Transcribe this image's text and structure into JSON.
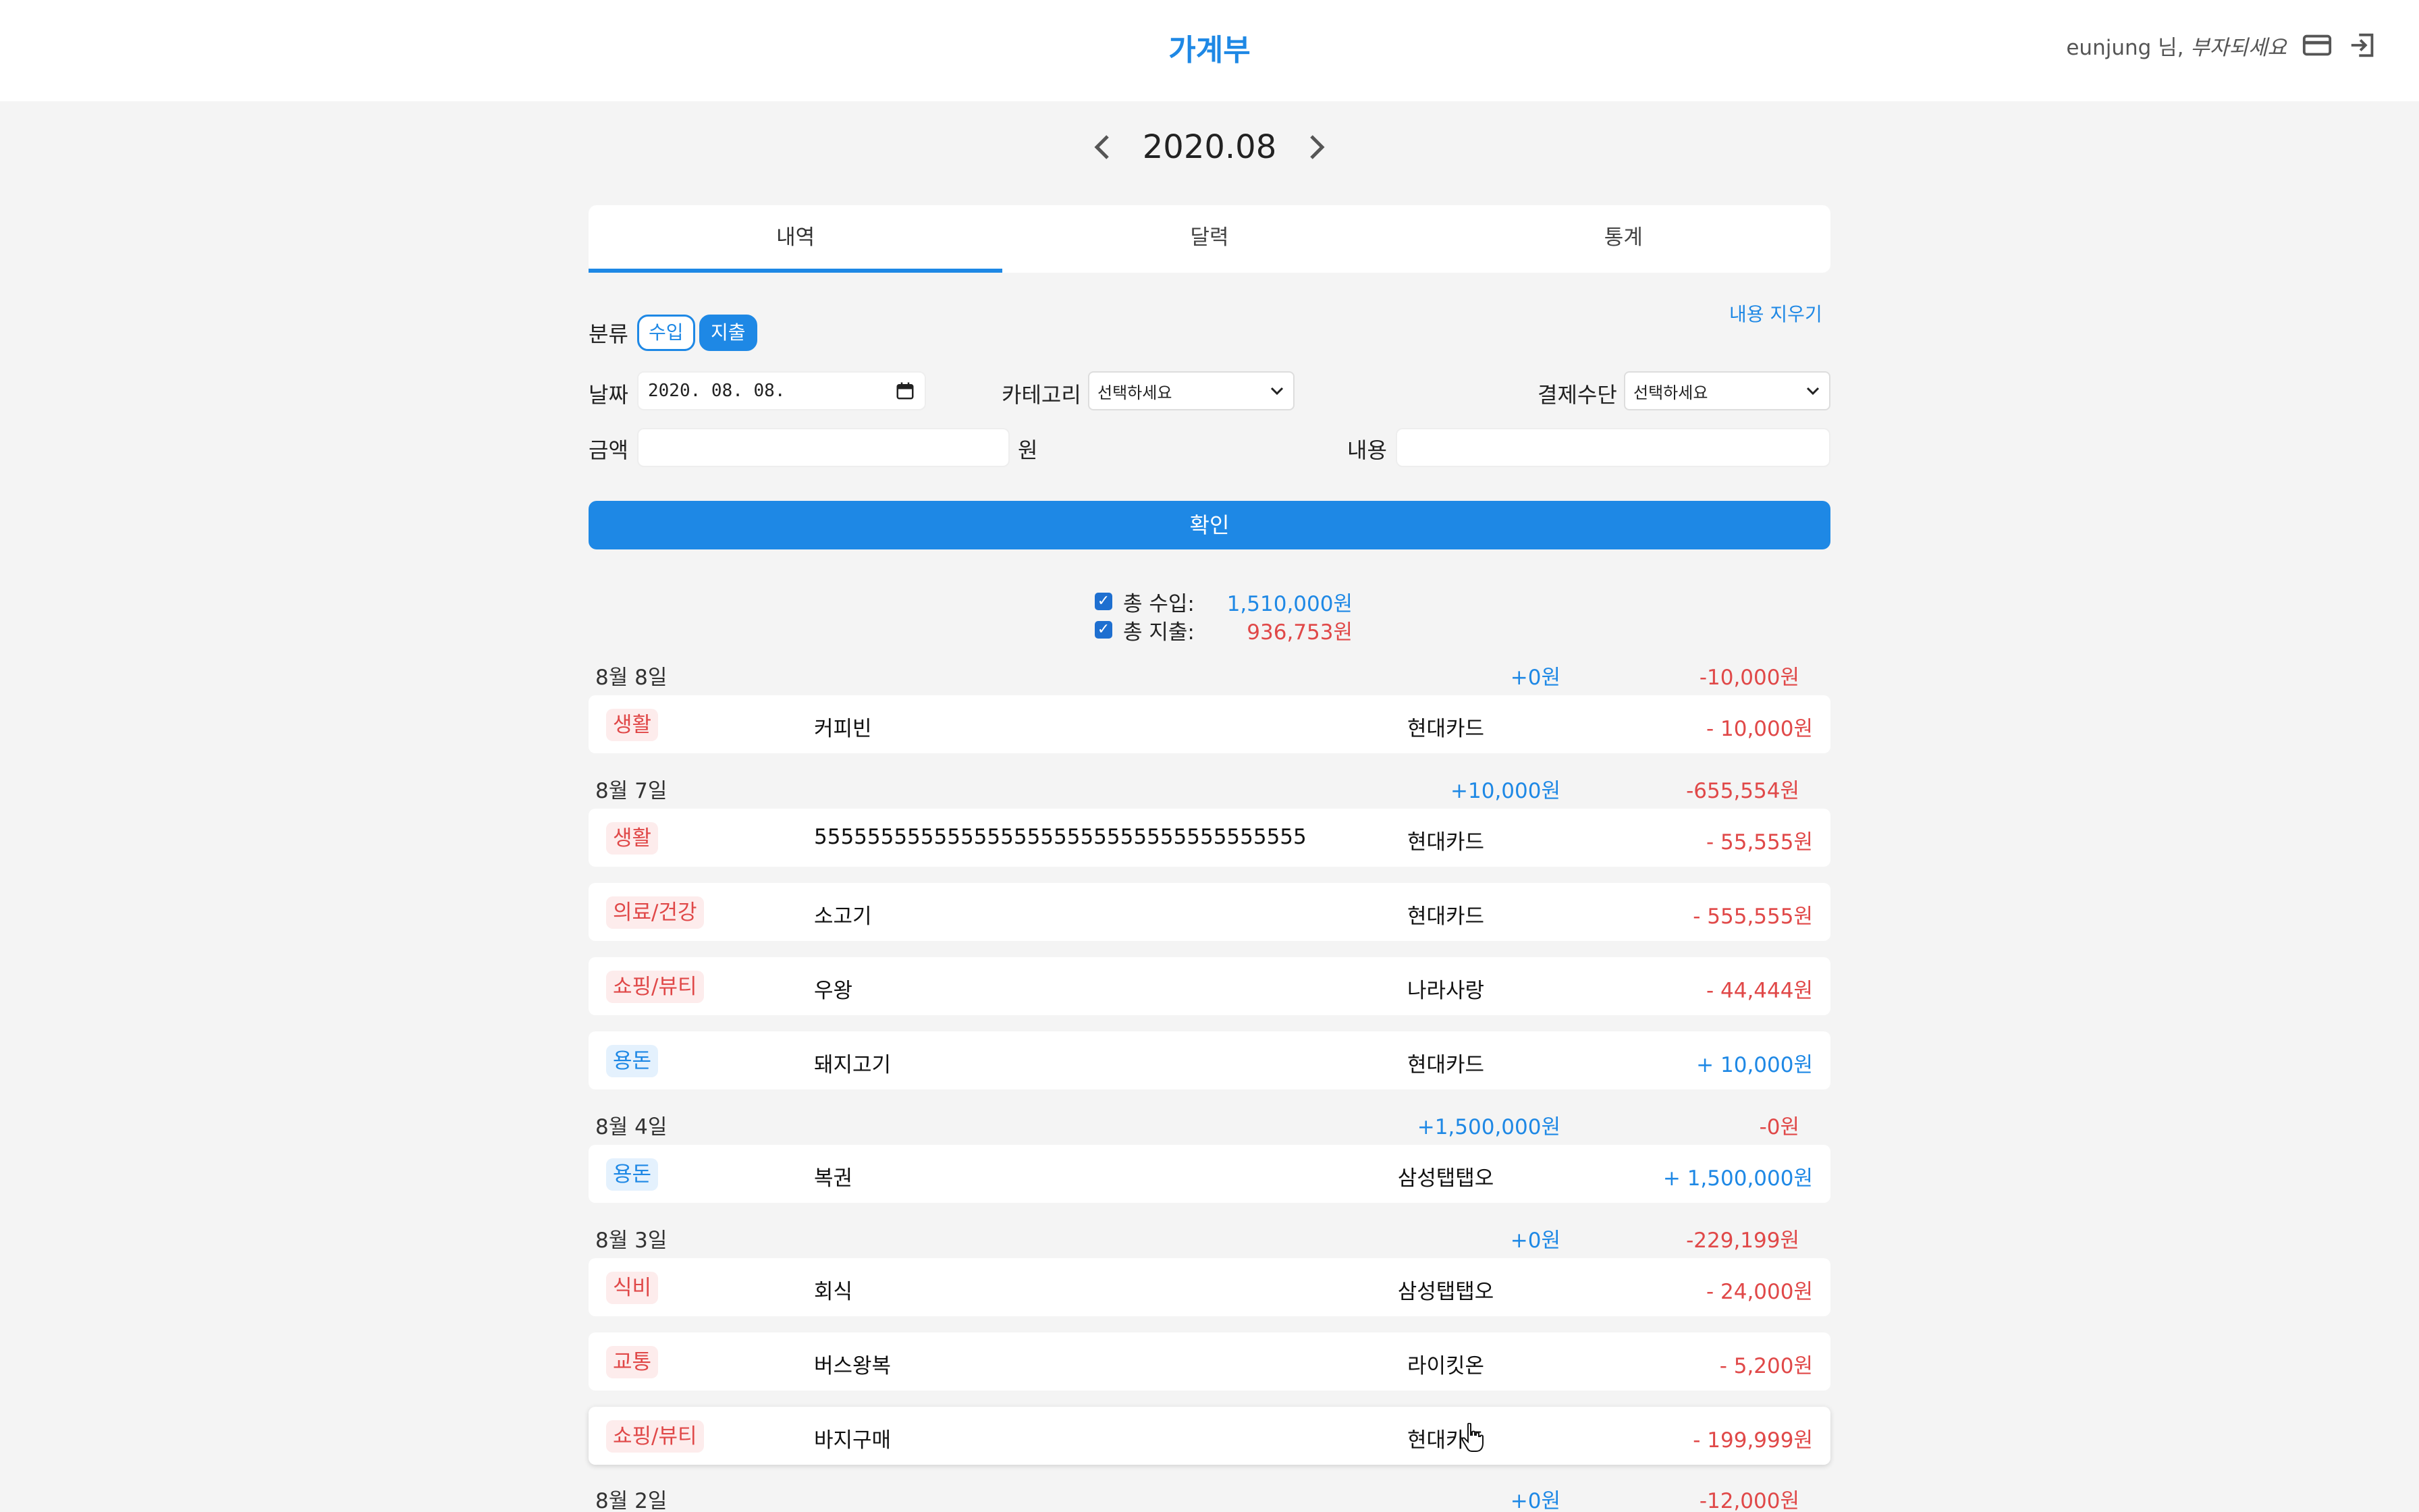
{
  "header": {
    "title": "가계부",
    "user_name": "eunjung 님,",
    "greeting": "부자되세요",
    "card_icon": "credit-card-icon",
    "logout_icon": "logout-icon"
  },
  "month_nav": {
    "label": "2020.08"
  },
  "tabs": [
    {
      "label": "내역",
      "active": true
    },
    {
      "label": "달력",
      "active": false
    },
    {
      "label": "통계",
      "active": false
    }
  ],
  "form": {
    "clear_label": "내용 지우기",
    "category_type_label": "분류",
    "income_chip": "수입",
    "expense_chip": "지출",
    "date_label": "날짜",
    "date_value": "2020. 08. 08.",
    "category_label": "카테고리",
    "category_value": "선택하세요",
    "payment_label": "결제수단",
    "payment_value": "선택하세요",
    "amount_label": "금액",
    "amount_unit": "원",
    "amount_value": "",
    "memo_label": "내용",
    "memo_value": "",
    "confirm_label": "확인"
  },
  "totals": {
    "income_label": "총 수입:",
    "income_value": "1,510,000원",
    "expense_label": "총 지출:",
    "expense_value": "936,753원"
  },
  "days": [
    {
      "date": "8월 8일",
      "income": "+0원",
      "expense": "-10,000원",
      "items": [
        {
          "category": "생활",
          "type": "expense",
          "content": "커피빈",
          "payment": "현대카드",
          "amount": "- 10,000원"
        }
      ]
    },
    {
      "date": "8월 7일",
      "income": "+10,000원",
      "expense": "-655,554원",
      "items": [
        {
          "category": "생활",
          "type": "expense",
          "content": "5555555555555555555555555555555555555",
          "payment": "현대카드",
          "amount": "- 55,555원"
        },
        {
          "category": "의료/건강",
          "type": "expense",
          "content": "소고기",
          "payment": "현대카드",
          "amount": "- 555,555원"
        },
        {
          "category": "쇼핑/뷰티",
          "type": "expense",
          "content": "우왕",
          "payment": "나라사랑",
          "amount": "- 44,444원"
        },
        {
          "category": "용돈",
          "type": "income",
          "content": "돼지고기",
          "payment": "현대카드",
          "amount": "+ 10,000원"
        }
      ]
    },
    {
      "date": "8월 4일",
      "income": "+1,500,000원",
      "expense": "-0원",
      "items": [
        {
          "category": "용돈",
          "type": "income",
          "content": "복권",
          "payment": "삼성탭탭오",
          "amount": "+ 1,500,000원"
        }
      ]
    },
    {
      "date": "8월 3일",
      "income": "+0원",
      "expense": "-229,199원",
      "items": [
        {
          "category": "식비",
          "type": "expense",
          "content": "회식",
          "payment": "삼성탭탭오",
          "amount": "- 24,000원"
        },
        {
          "category": "교통",
          "type": "expense",
          "content": "버스왕복",
          "payment": "라이킷온",
          "amount": "- 5,200원"
        },
        {
          "category": "쇼핑/뷰티",
          "type": "expense",
          "content": "바지구매",
          "payment": "현대카드",
          "amount": "- 199,999원"
        }
      ]
    },
    {
      "date": "8월 2일",
      "income": "+0원",
      "expense": "-12,000원",
      "items": []
    }
  ],
  "colors": {
    "accent": "#1e88e5",
    "expense": "#e04848",
    "expense_bg": "#fdecec",
    "income_bg": "#e4f1fd"
  }
}
